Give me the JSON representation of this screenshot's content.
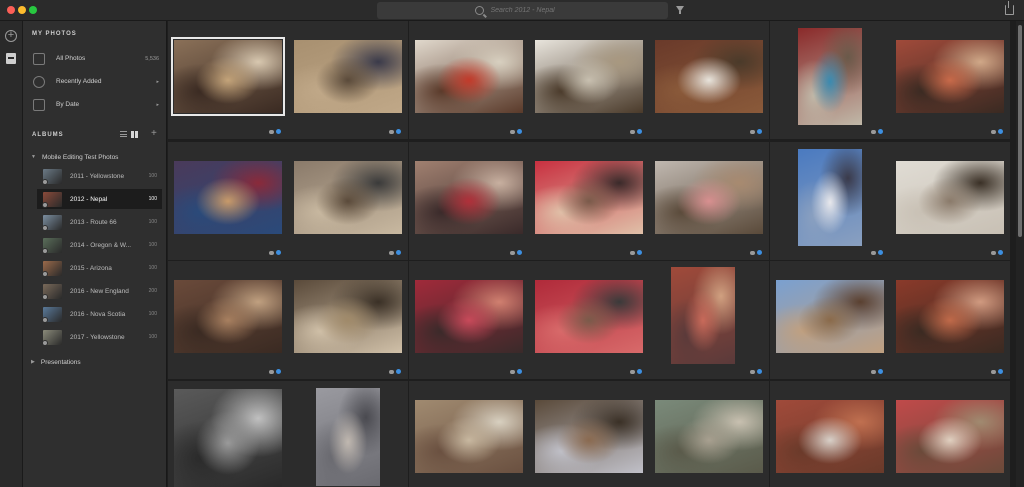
{
  "window": {
    "search_placeholder": "Search 2012 - Nepal"
  },
  "sidebar": {
    "my_photos_heading": "MY PHOTOS",
    "nav": [
      {
        "label": "All Photos",
        "count": "5,536",
        "icon": "photos-icon"
      },
      {
        "label": "Recently Added",
        "count": "▸",
        "icon": "clock-icon"
      },
      {
        "label": "By Date",
        "count": "▸",
        "icon": "calendar-icon"
      }
    ],
    "albums_heading": "ALBUMS",
    "folder": "Mobile Editing Test Photos",
    "albums": [
      {
        "label": "2011 - Yellowstone",
        "count": "100",
        "active": false,
        "color": "#6b7a86"
      },
      {
        "label": "2012 - Nepal",
        "count": "100",
        "active": true,
        "color": "#8a4a3a"
      },
      {
        "label": "2013 - Route 66",
        "count": "100",
        "active": false,
        "color": "#7b8ea0"
      },
      {
        "label": "2014 - Oregon & W...",
        "count": "100",
        "active": false,
        "color": "#5a6e5a"
      },
      {
        "label": "2015 - Arizona",
        "count": "100",
        "active": false,
        "color": "#9a6a4a"
      },
      {
        "label": "2016 - New England",
        "count": "200",
        "active": false,
        "color": "#7a6a5a"
      },
      {
        "label": "2016 - Nova Scotia",
        "count": "100",
        "active": false,
        "color": "#5a7a9a"
      },
      {
        "label": "2017 - Yellowstone",
        "count": "100",
        "active": false,
        "color": "#8a8a7a"
      }
    ],
    "presentations": "Presentations"
  },
  "grid": {
    "photos": [
      {
        "name": "photo-boys-on-steps",
        "palette": [
          "#8a7058",
          "#c4a47a",
          "#3a2a22",
          "#d8c8b0"
        ],
        "sel": true
      },
      {
        "name": "photo-people-sitting",
        "palette": [
          "#a89070",
          "#5a4a3a",
          "#c0a888",
          "#3a3a4a"
        ]
      },
      {
        "name": "photo-red-shrine-figure",
        "palette": [
          "#e0d8cc",
          "#c23a2a",
          "#5a3a2a",
          "#d8d0c0"
        ]
      },
      {
        "name": "photo-white-shrine-door",
        "palette": [
          "#e8e4dc",
          "#c8c0b0",
          "#4a3a2a",
          "#a89880"
        ]
      },
      {
        "name": "photo-temple-courtyard",
        "palette": [
          "#6a3a2a",
          "#e8e4dc",
          "#8a5a3a",
          "#4a3a2a"
        ]
      },
      {
        "name": "photo-two-women-wall",
        "palette": [
          "#8a2a2a",
          "#3a8ab0",
          "#c0b8a8",
          "#6a5a4a"
        ]
      },
      {
        "name": "photo-red-steps-person",
        "palette": [
          "#a04a3a",
          "#c86a4a",
          "#3a2a22",
          "#d0a888"
        ]
      },
      {
        "name": "photo-girl-portrait",
        "palette": [
          "#4a3a5a",
          "#c89a6a",
          "#2a4a7a",
          "#8a2a3a"
        ]
      },
      {
        "name": "photo-man-grey-cap",
        "palette": [
          "#8a7a6a",
          "#5a4a3a",
          "#c8b8a0",
          "#3a3a3a"
        ]
      },
      {
        "name": "photo-seated-women-red",
        "palette": [
          "#a08070",
          "#b0303a",
          "#3a2a2a",
          "#c8b0a0"
        ]
      },
      {
        "name": "photo-woman-red-shawl",
        "palette": [
          "#c83040",
          "#7a5a4a",
          "#e0c0a8",
          "#3a2a2a"
        ]
      },
      {
        "name": "photo-man-pink-shawl",
        "palette": [
          "#c0b8b0",
          "#d89090",
          "#5a4a3a",
          "#a88a70"
        ]
      },
      {
        "name": "photo-white-stupa",
        "palette": [
          "#4a7ac0",
          "#e8e8ec",
          "#8aa0c0",
          "#3a3a4a"
        ]
      },
      {
        "name": "photo-white-shrine-statue",
        "palette": [
          "#e0dcd4",
          "#8a7a6a",
          "#c8c0b4",
          "#3a3026"
        ]
      },
      {
        "name": "photo-prayer-wheels-closeup",
        "palette": [
          "#6a4a3a",
          "#a88060",
          "#3a2a22",
          "#c0a080"
        ]
      },
      {
        "name": "photo-prayer-wheels-row",
        "palette": [
          "#5a4a3a",
          "#a08a6a",
          "#d0c0a8",
          "#3a3026"
        ]
      },
      {
        "name": "photo-crowd-red-robes",
        "palette": [
          "#a02a3a",
          "#c84a5a",
          "#3a2a2a",
          "#d08070"
        ]
      },
      {
        "name": "photo-group-red-robes",
        "palette": [
          "#b02a3a",
          "#7a5a4a",
          "#d86a6a",
          "#3a3a3a"
        ]
      },
      {
        "name": "photo-seated-woman-child",
        "palette": [
          "#a04a3a",
          "#c86a5a",
          "#5a3a3a",
          "#d0a080"
        ]
      },
      {
        "name": "photo-pagoda-square",
        "palette": [
          "#7aa0d0",
          "#8a6a4a",
          "#c0a080",
          "#5a4030"
        ]
      },
      {
        "name": "photo-woman-in-window",
        "palette": [
          "#8a3a2a",
          "#c06a4a",
          "#3a2a22",
          "#d09a80"
        ]
      },
      {
        "name": "photo-old-man-bw",
        "palette": [
          "#5a5a5a",
          "#9a9a9a",
          "#2a2a2a",
          "#c0c0c0"
        ]
      },
      {
        "name": "photo-courtyard-shrine-pigeons",
        "palette": [
          "#9a9aa0",
          "#c0b8b0",
          "#6a6a70",
          "#4a4a50"
        ]
      },
      {
        "name": "photo-courtyard-pavilion",
        "palette": [
          "#a08a70",
          "#c8b8a0",
          "#6a5040",
          "#d8d0c0"
        ]
      },
      {
        "name": "photo-clay-pots",
        "palette": [
          "#5a4a3a",
          "#8a6a50",
          "#c0c0c8",
          "#3a3026"
        ]
      },
      {
        "name": "photo-woman-well",
        "palette": [
          "#7a8a7a",
          "#a8a090",
          "#5a5a4a",
          "#c8c0b0"
        ]
      },
      {
        "name": "photo-bearded-man",
        "palette": [
          "#a04a3a",
          "#d8d0c8",
          "#6a3a2a",
          "#c07050"
        ]
      },
      {
        "name": "photo-man-topi-hat",
        "palette": [
          "#c04a4a",
          "#e0d0c0",
          "#6a4a3a",
          "#a08a70"
        ]
      }
    ]
  }
}
